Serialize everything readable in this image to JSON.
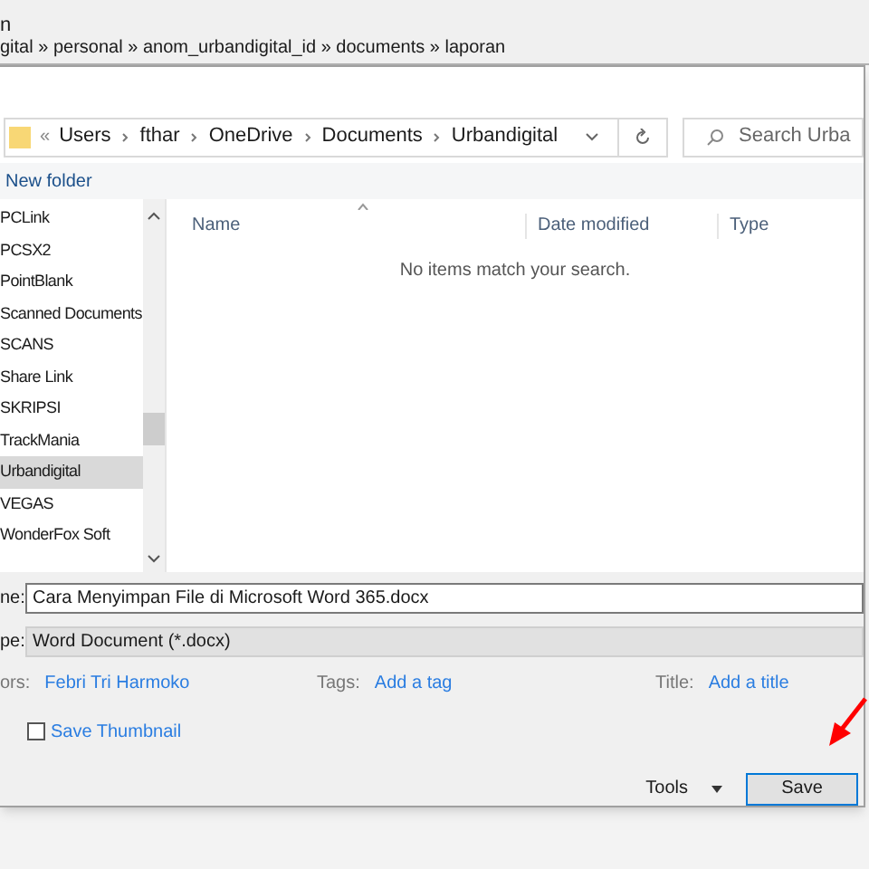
{
  "background_window": {
    "title": "n",
    "path": "gital » personal » anom_urbandigital_id » documents » laporan"
  },
  "address_bar": {
    "crumbs": [
      "Users",
      "fthar",
      "OneDrive",
      "Documents",
      "Urbandigital"
    ],
    "overflow": "«"
  },
  "search": {
    "placeholder": "Search Urba"
  },
  "toolbar": {
    "new_folder": "New folder"
  },
  "nav_items": [
    {
      "label": "PCLink",
      "selected": false
    },
    {
      "label": "PCSX2",
      "selected": false
    },
    {
      "label": "PointBlank",
      "selected": false
    },
    {
      "label": "Scanned Documents",
      "selected": false
    },
    {
      "label": "SCANS",
      "selected": false
    },
    {
      "label": "Share Link",
      "selected": false
    },
    {
      "label": "SKRIPSI",
      "selected": false
    },
    {
      "label": "TrackMania",
      "selected": false
    },
    {
      "label": "Urbandigital",
      "selected": true
    },
    {
      "label": "VEGAS",
      "selected": false
    },
    {
      "label": "WonderFox Soft",
      "selected": false
    }
  ],
  "columns": [
    "Name",
    "Date modified",
    "Type"
  ],
  "empty_message": "No items match your search.",
  "file_name": {
    "label": "ne:",
    "value": "Cara Menyimpan File di Microsoft Word 365.docx"
  },
  "file_type": {
    "label": "pe:",
    "value": "Word Document (*.docx)"
  },
  "metadata": [
    {
      "label": "ors:",
      "value": "Febri Tri Harmoko"
    },
    {
      "label": "Tags:",
      "value": "Add a tag"
    },
    {
      "label": "Title:",
      "value": "Add a title"
    }
  ],
  "save_thumbnail": {
    "label": "Save Thumbnail",
    "checked": false
  },
  "tools": "Tools",
  "save": "Save"
}
